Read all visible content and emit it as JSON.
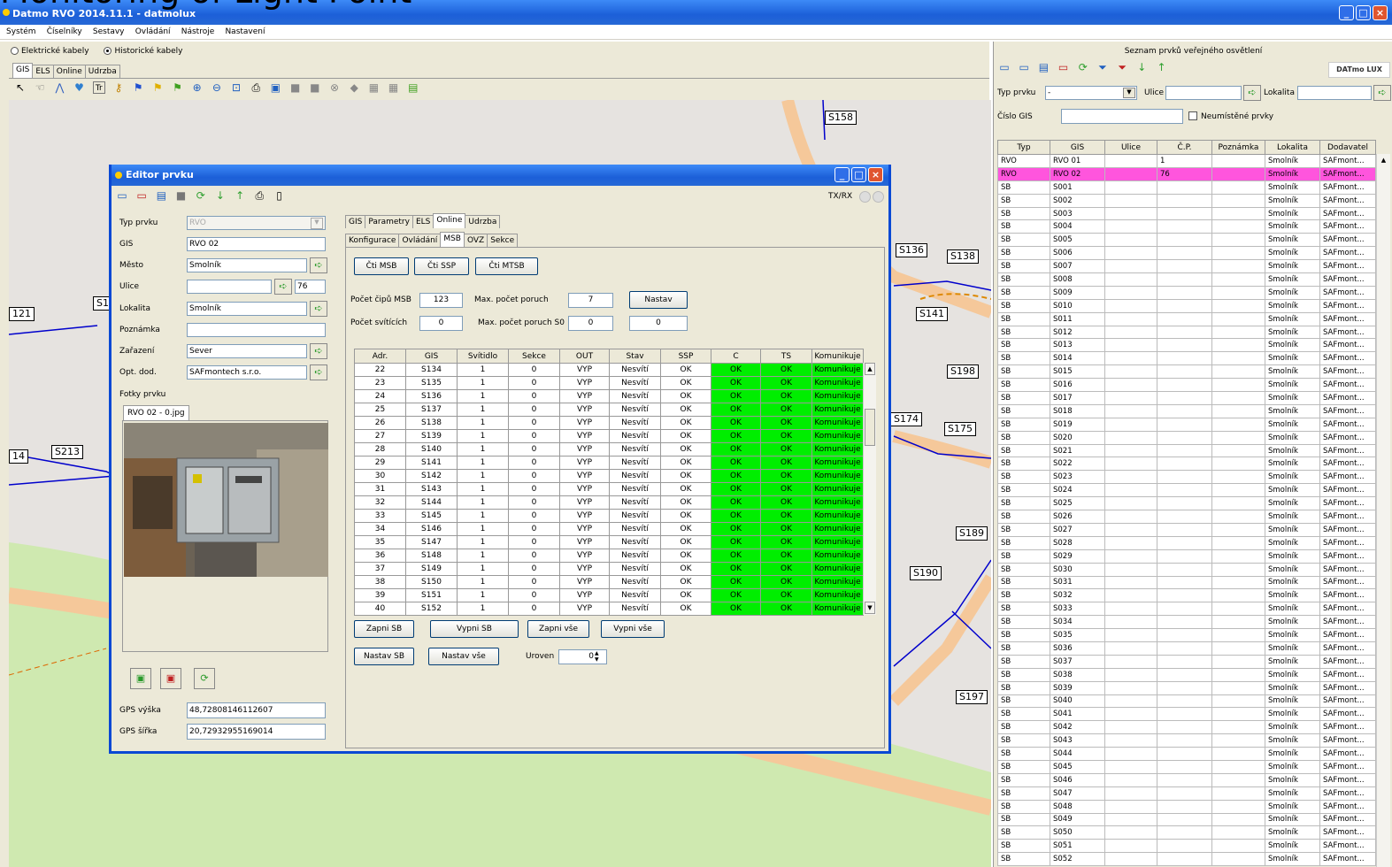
{
  "app": {
    "title": "Datmo RVO 2014.11.1 - datmolux"
  },
  "slide_heading": "Monitoring of Light Point",
  "menu": [
    "Systém",
    "Číselníky",
    "Sestavy",
    "Ovládání",
    "Nástroje",
    "Nastavení"
  ],
  "cable_mode": {
    "option1": "Elektrické kabely",
    "option2": "Historické kabely",
    "selected": "Historické kabely"
  },
  "main_tabs": [
    "GIS",
    "ELS",
    "Online",
    "Udrzba"
  ],
  "map_labels": [
    "S158",
    "S136",
    "S138",
    "S141",
    "S198",
    "S174",
    "S175",
    "S189",
    "S190",
    "S197",
    "S213",
    "121",
    "14",
    "S1"
  ],
  "editor": {
    "title": "Editor prvku",
    "txrx": "TX/RX",
    "fields": {
      "typ_prvku": {
        "label": "Typ prvku",
        "value": "RVO"
      },
      "gis": {
        "label": "GIS",
        "value": "RVO 02"
      },
      "mesto": {
        "label": "Město",
        "value": "Smolník"
      },
      "ulice": {
        "label": "Ulice",
        "value": "",
        "cp": "76"
      },
      "lokalita": {
        "label": "Lokalita",
        "value": "Smolník"
      },
      "poznamka": {
        "label": "Poznámka",
        "value": ""
      },
      "zarazeni": {
        "label": "Zařazení",
        "value": "Sever"
      },
      "opt_dod": {
        "label": "Opt. dod.",
        "value": "SAFmontech s.r.o."
      }
    },
    "photos_label": "Fotky prvku",
    "photo_tab": "RVO 02 - 0.jpg",
    "gps_vyska": {
      "label": "GPS výška",
      "value": "48,72808146112607"
    },
    "gps_sirka": {
      "label": "GPS šířka",
      "value": "20,72932955169014"
    },
    "tabs": [
      "GIS",
      "Parametry",
      "ELS",
      "Online",
      "Udrzba"
    ],
    "subtabs": [
      "Konfigurace",
      "Ovládání",
      "MSB",
      "OVZ",
      "Sekce"
    ],
    "buttons": {
      "cti_msb": "Čti MSB",
      "cti_ssp": "Čti SSP",
      "cti_mtsb": "Čti MTSB",
      "nastav": "Nastav",
      "zapni_sb": "Zapni SB",
      "vypni_sb": "Vypni SB",
      "zapni_vse": "Zapni vše",
      "vypni_vse": "Vypni vše",
      "nastav_sb": "Nastav SB",
      "nastav_vse": "Nastav vše"
    },
    "params": {
      "pocet_cipu_label": "Počet čipů MSB",
      "pocet_cipu": "123",
      "max_poruch_label": "Max. počet poruch",
      "max_poruch": "7",
      "pocet_svitidel_label": "Počet svítících",
      "pocet_svitidel": "0",
      "max_poruch_s0_label": "Max. počet poruch S0",
      "max_poruch_s0": "0",
      "extra_value": "0",
      "uroven_label": "Uroven",
      "uroven": "0"
    },
    "msb_columns": [
      "Adr.",
      "GIS",
      "Svítidlo",
      "Sekce",
      "OUT",
      "Stav",
      "SSP",
      "C",
      "TS",
      "Komunikuje"
    ],
    "msb_rows": [
      [
        "22",
        "S134",
        "1",
        "0",
        "VYP",
        "Nesvítí",
        "OK",
        "OK",
        "OK",
        "Komunikuje"
      ],
      [
        "23",
        "S135",
        "1",
        "0",
        "VYP",
        "Nesvítí",
        "OK",
        "OK",
        "OK",
        "Komunikuje"
      ],
      [
        "24",
        "S136",
        "1",
        "0",
        "VYP",
        "Nesvítí",
        "OK",
        "OK",
        "OK",
        "Komunikuje"
      ],
      [
        "25",
        "S137",
        "1",
        "0",
        "VYP",
        "Nesvítí",
        "OK",
        "OK",
        "OK",
        "Komunikuje"
      ],
      [
        "26",
        "S138",
        "1",
        "0",
        "VYP",
        "Nesvítí",
        "OK",
        "OK",
        "OK",
        "Komunikuje"
      ],
      [
        "27",
        "S139",
        "1",
        "0",
        "VYP",
        "Nesvítí",
        "OK",
        "OK",
        "OK",
        "Komunikuje"
      ],
      [
        "28",
        "S140",
        "1",
        "0",
        "VYP",
        "Nesvítí",
        "OK",
        "OK",
        "OK",
        "Komunikuje"
      ],
      [
        "29",
        "S141",
        "1",
        "0",
        "VYP",
        "Nesvítí",
        "OK",
        "OK",
        "OK",
        "Komunikuje"
      ],
      [
        "30",
        "S142",
        "1",
        "0",
        "VYP",
        "Nesvítí",
        "OK",
        "OK",
        "OK",
        "Komunikuje"
      ],
      [
        "31",
        "S143",
        "1",
        "0",
        "VYP",
        "Nesvítí",
        "OK",
        "OK",
        "OK",
        "Komunikuje"
      ],
      [
        "32",
        "S144",
        "1",
        "0",
        "VYP",
        "Nesvítí",
        "OK",
        "OK",
        "OK",
        "Komunikuje"
      ],
      [
        "33",
        "S145",
        "1",
        "0",
        "VYP",
        "Nesvítí",
        "OK",
        "OK",
        "OK",
        "Komunikuje"
      ],
      [
        "34",
        "S146",
        "1",
        "0",
        "VYP",
        "Nesvítí",
        "OK",
        "OK",
        "OK",
        "Komunikuje"
      ],
      [
        "35",
        "S147",
        "1",
        "0",
        "VYP",
        "Nesvítí",
        "OK",
        "OK",
        "OK",
        "Komunikuje"
      ],
      [
        "36",
        "S148",
        "1",
        "0",
        "VYP",
        "Nesvítí",
        "OK",
        "OK",
        "OK",
        "Komunikuje"
      ],
      [
        "37",
        "S149",
        "1",
        "0",
        "VYP",
        "Nesvítí",
        "OK",
        "OK",
        "OK",
        "Komunikuje"
      ],
      [
        "38",
        "S150",
        "1",
        "0",
        "VYP",
        "Nesvítí",
        "OK",
        "OK",
        "OK",
        "Komunikuje"
      ],
      [
        "39",
        "S151",
        "1",
        "0",
        "VYP",
        "Nesvítí",
        "OK",
        "OK",
        "OK",
        "Komunikuje"
      ],
      [
        "40",
        "S152",
        "1",
        "0",
        "VYP",
        "Nesvítí",
        "OK",
        "OK",
        "OK",
        "Komunikuje"
      ]
    ]
  },
  "list_panel": {
    "title": "Seznam prvků veřejného osvětlení",
    "logo": "DATmo LUX",
    "filter_typ_label": "Typ prvku",
    "filter_typ_value": "-",
    "filter_ulice_label": "Ulice",
    "filter_lokalita_label": "Lokalita",
    "cislo_gis_label": "Číslo GIS",
    "neumistene_label": "Neumístěné prvky",
    "columns": [
      "Typ",
      "GIS",
      "Ulice",
      "Č.P.",
      "Poznámka",
      "Lokalita",
      "Dodavatel"
    ],
    "rows": [
      [
        "RVO",
        "RVO 01",
        "",
        "1",
        "",
        "Smolník",
        "SAFmont..."
      ],
      [
        "RVO",
        "RVO 02",
        "",
        "76",
        "",
        "Smolník",
        "SAFmont..."
      ],
      [
        "SB",
        "S001",
        "",
        "",
        "",
        "Smolník",
        "SAFmont..."
      ],
      [
        "SB",
        "S002",
        "",
        "",
        "",
        "Smolník",
        "SAFmont..."
      ],
      [
        "SB",
        "S003",
        "",
        "",
        "",
        "Smolník",
        "SAFmont..."
      ],
      [
        "SB",
        "S004",
        "",
        "",
        "",
        "Smolník",
        "SAFmont..."
      ],
      [
        "SB",
        "S005",
        "",
        "",
        "",
        "Smolník",
        "SAFmont..."
      ],
      [
        "SB",
        "S006",
        "",
        "",
        "",
        "Smolník",
        "SAFmont..."
      ],
      [
        "SB",
        "S007",
        "",
        "",
        "",
        "Smolník",
        "SAFmont..."
      ],
      [
        "SB",
        "S008",
        "",
        "",
        "",
        "Smolník",
        "SAFmont..."
      ],
      [
        "SB",
        "S009",
        "",
        "",
        "",
        "Smolník",
        "SAFmont..."
      ],
      [
        "SB",
        "S010",
        "",
        "",
        "",
        "Smolník",
        "SAFmont..."
      ],
      [
        "SB",
        "S011",
        "",
        "",
        "",
        "Smolník",
        "SAFmont..."
      ],
      [
        "SB",
        "S012",
        "",
        "",
        "",
        "Smolník",
        "SAFmont..."
      ],
      [
        "SB",
        "S013",
        "",
        "",
        "",
        "Smolník",
        "SAFmont..."
      ],
      [
        "SB",
        "S014",
        "",
        "",
        "",
        "Smolník",
        "SAFmont..."
      ],
      [
        "SB",
        "S015",
        "",
        "",
        "",
        "Smolník",
        "SAFmont..."
      ],
      [
        "SB",
        "S016",
        "",
        "",
        "",
        "Smolník",
        "SAFmont..."
      ],
      [
        "SB",
        "S017",
        "",
        "",
        "",
        "Smolník",
        "SAFmont..."
      ],
      [
        "SB",
        "S018",
        "",
        "",
        "",
        "Smolník",
        "SAFmont..."
      ],
      [
        "SB",
        "S019",
        "",
        "",
        "",
        "Smolník",
        "SAFmont..."
      ],
      [
        "SB",
        "S020",
        "",
        "",
        "",
        "Smolník",
        "SAFmont..."
      ],
      [
        "SB",
        "S021",
        "",
        "",
        "",
        "Smolník",
        "SAFmont..."
      ],
      [
        "SB",
        "S022",
        "",
        "",
        "",
        "Smolník",
        "SAFmont..."
      ],
      [
        "SB",
        "S023",
        "",
        "",
        "",
        "Smolník",
        "SAFmont..."
      ],
      [
        "SB",
        "S024",
        "",
        "",
        "",
        "Smolník",
        "SAFmont..."
      ],
      [
        "SB",
        "S025",
        "",
        "",
        "",
        "Smolník",
        "SAFmont..."
      ],
      [
        "SB",
        "S026",
        "",
        "",
        "",
        "Smolník",
        "SAFmont..."
      ],
      [
        "SB",
        "S027",
        "",
        "",
        "",
        "Smolník",
        "SAFmont..."
      ],
      [
        "SB",
        "S028",
        "",
        "",
        "",
        "Smolník",
        "SAFmont..."
      ],
      [
        "SB",
        "S029",
        "",
        "",
        "",
        "Smolník",
        "SAFmont..."
      ],
      [
        "SB",
        "S030",
        "",
        "",
        "",
        "Smolník",
        "SAFmont..."
      ],
      [
        "SB",
        "S031",
        "",
        "",
        "",
        "Smolník",
        "SAFmont..."
      ],
      [
        "SB",
        "S032",
        "",
        "",
        "",
        "Smolník",
        "SAFmont..."
      ],
      [
        "SB",
        "S033",
        "",
        "",
        "",
        "Smolník",
        "SAFmont..."
      ],
      [
        "SB",
        "S034",
        "",
        "",
        "",
        "Smolník",
        "SAFmont..."
      ],
      [
        "SB",
        "S035",
        "",
        "",
        "",
        "Smolník",
        "SAFmont..."
      ],
      [
        "SB",
        "S036",
        "",
        "",
        "",
        "Smolník",
        "SAFmont..."
      ],
      [
        "SB",
        "S037",
        "",
        "",
        "",
        "Smolník",
        "SAFmont..."
      ],
      [
        "SB",
        "S038",
        "",
        "",
        "",
        "Smolník",
        "SAFmont..."
      ],
      [
        "SB",
        "S039",
        "",
        "",
        "",
        "Smolník",
        "SAFmont..."
      ],
      [
        "SB",
        "S040",
        "",
        "",
        "",
        "Smolník",
        "SAFmont..."
      ],
      [
        "SB",
        "S041",
        "",
        "",
        "",
        "Smolník",
        "SAFmont..."
      ],
      [
        "SB",
        "S042",
        "",
        "",
        "",
        "Smolník",
        "SAFmont..."
      ],
      [
        "SB",
        "S043",
        "",
        "",
        "",
        "Smolník",
        "SAFmont..."
      ],
      [
        "SB",
        "S044",
        "",
        "",
        "",
        "Smolník",
        "SAFmont..."
      ],
      [
        "SB",
        "S045",
        "",
        "",
        "",
        "Smolník",
        "SAFmont..."
      ],
      [
        "SB",
        "S046",
        "",
        "",
        "",
        "Smolník",
        "SAFmont..."
      ],
      [
        "SB",
        "S047",
        "",
        "",
        "",
        "Smolník",
        "SAFmont..."
      ],
      [
        "SB",
        "S048",
        "",
        "",
        "",
        "Smolník",
        "SAFmont..."
      ],
      [
        "SB",
        "S049",
        "",
        "",
        "",
        "Smolník",
        "SAFmont..."
      ],
      [
        "SB",
        "S050",
        "",
        "",
        "",
        "Smolník",
        "SAFmont..."
      ],
      [
        "SB",
        "S051",
        "",
        "",
        "",
        "Smolník",
        "SAFmont..."
      ],
      [
        "SB",
        "S052",
        "",
        "",
        "",
        "Smolník",
        "SAFmont..."
      ]
    ],
    "selected_row": 1
  },
  "colors": {
    "titlebar": "#1c5fd8",
    "ok_green": "#00ee00",
    "selected_row": "#ff55dd"
  }
}
